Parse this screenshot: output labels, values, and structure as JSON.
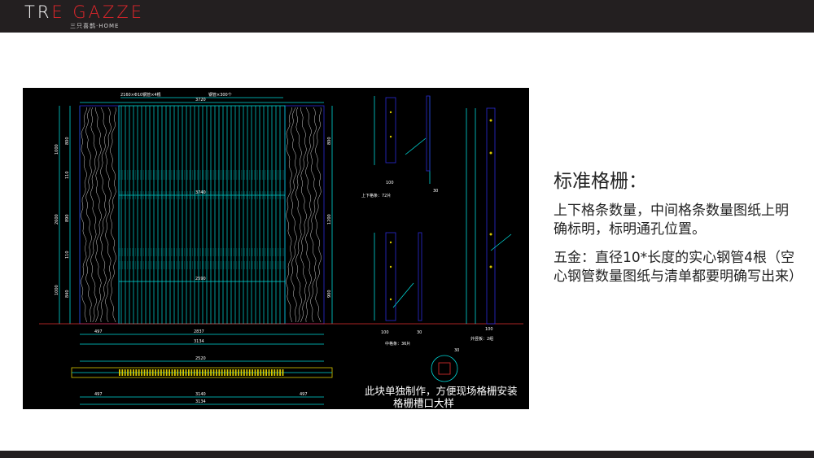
{
  "header": {
    "brand_part1": "TR",
    "brand_part2": "E GAZZE",
    "brand_sub": "三只喜鹊·HOME"
  },
  "drawing": {
    "top_dims": [
      "2160×Φ10钢管×4根",
      "钢管×300个",
      "3720"
    ],
    "mid_dims": [
      "3740",
      "2590"
    ],
    "left_dims": [
      "1000",
      "800",
      "110",
      "2600",
      "890",
      "110",
      "1000",
      "840"
    ],
    "right_dims": [
      "800",
      "1200",
      "900"
    ],
    "bottom_dims": [
      "497",
      "2837",
      "3134"
    ],
    "plan_dims": [
      "2520",
      "497",
      "3140",
      "497",
      "3134"
    ],
    "part_labels": [
      "上下格条：72片",
      "中格条：36片",
      "外竖板：2组"
    ],
    "small_dims": [
      "100",
      "30",
      "100",
      "30",
      "100",
      "30"
    ],
    "caption_line1": "此块单独制作，方便现场格栅安装",
    "caption_line2": "格栅槽口大样"
  },
  "content": {
    "heading": "标准格栅：",
    "para1": "上下格条数量，中间格条数量图纸上明确标明，标明通孔位置。",
    "para2": "五金：直径10*长度的实心钢管4根（空心钢管数量图纸与清单都要明确写出来）"
  },
  "colors": {
    "header_bg": "#231f20",
    "cad_bg": "#000000",
    "cad_cyan": "#00d8d8",
    "cad_blue": "#2b2bd6",
    "cad_yellow": "#d8c800",
    "cad_red": "#e03030"
  }
}
